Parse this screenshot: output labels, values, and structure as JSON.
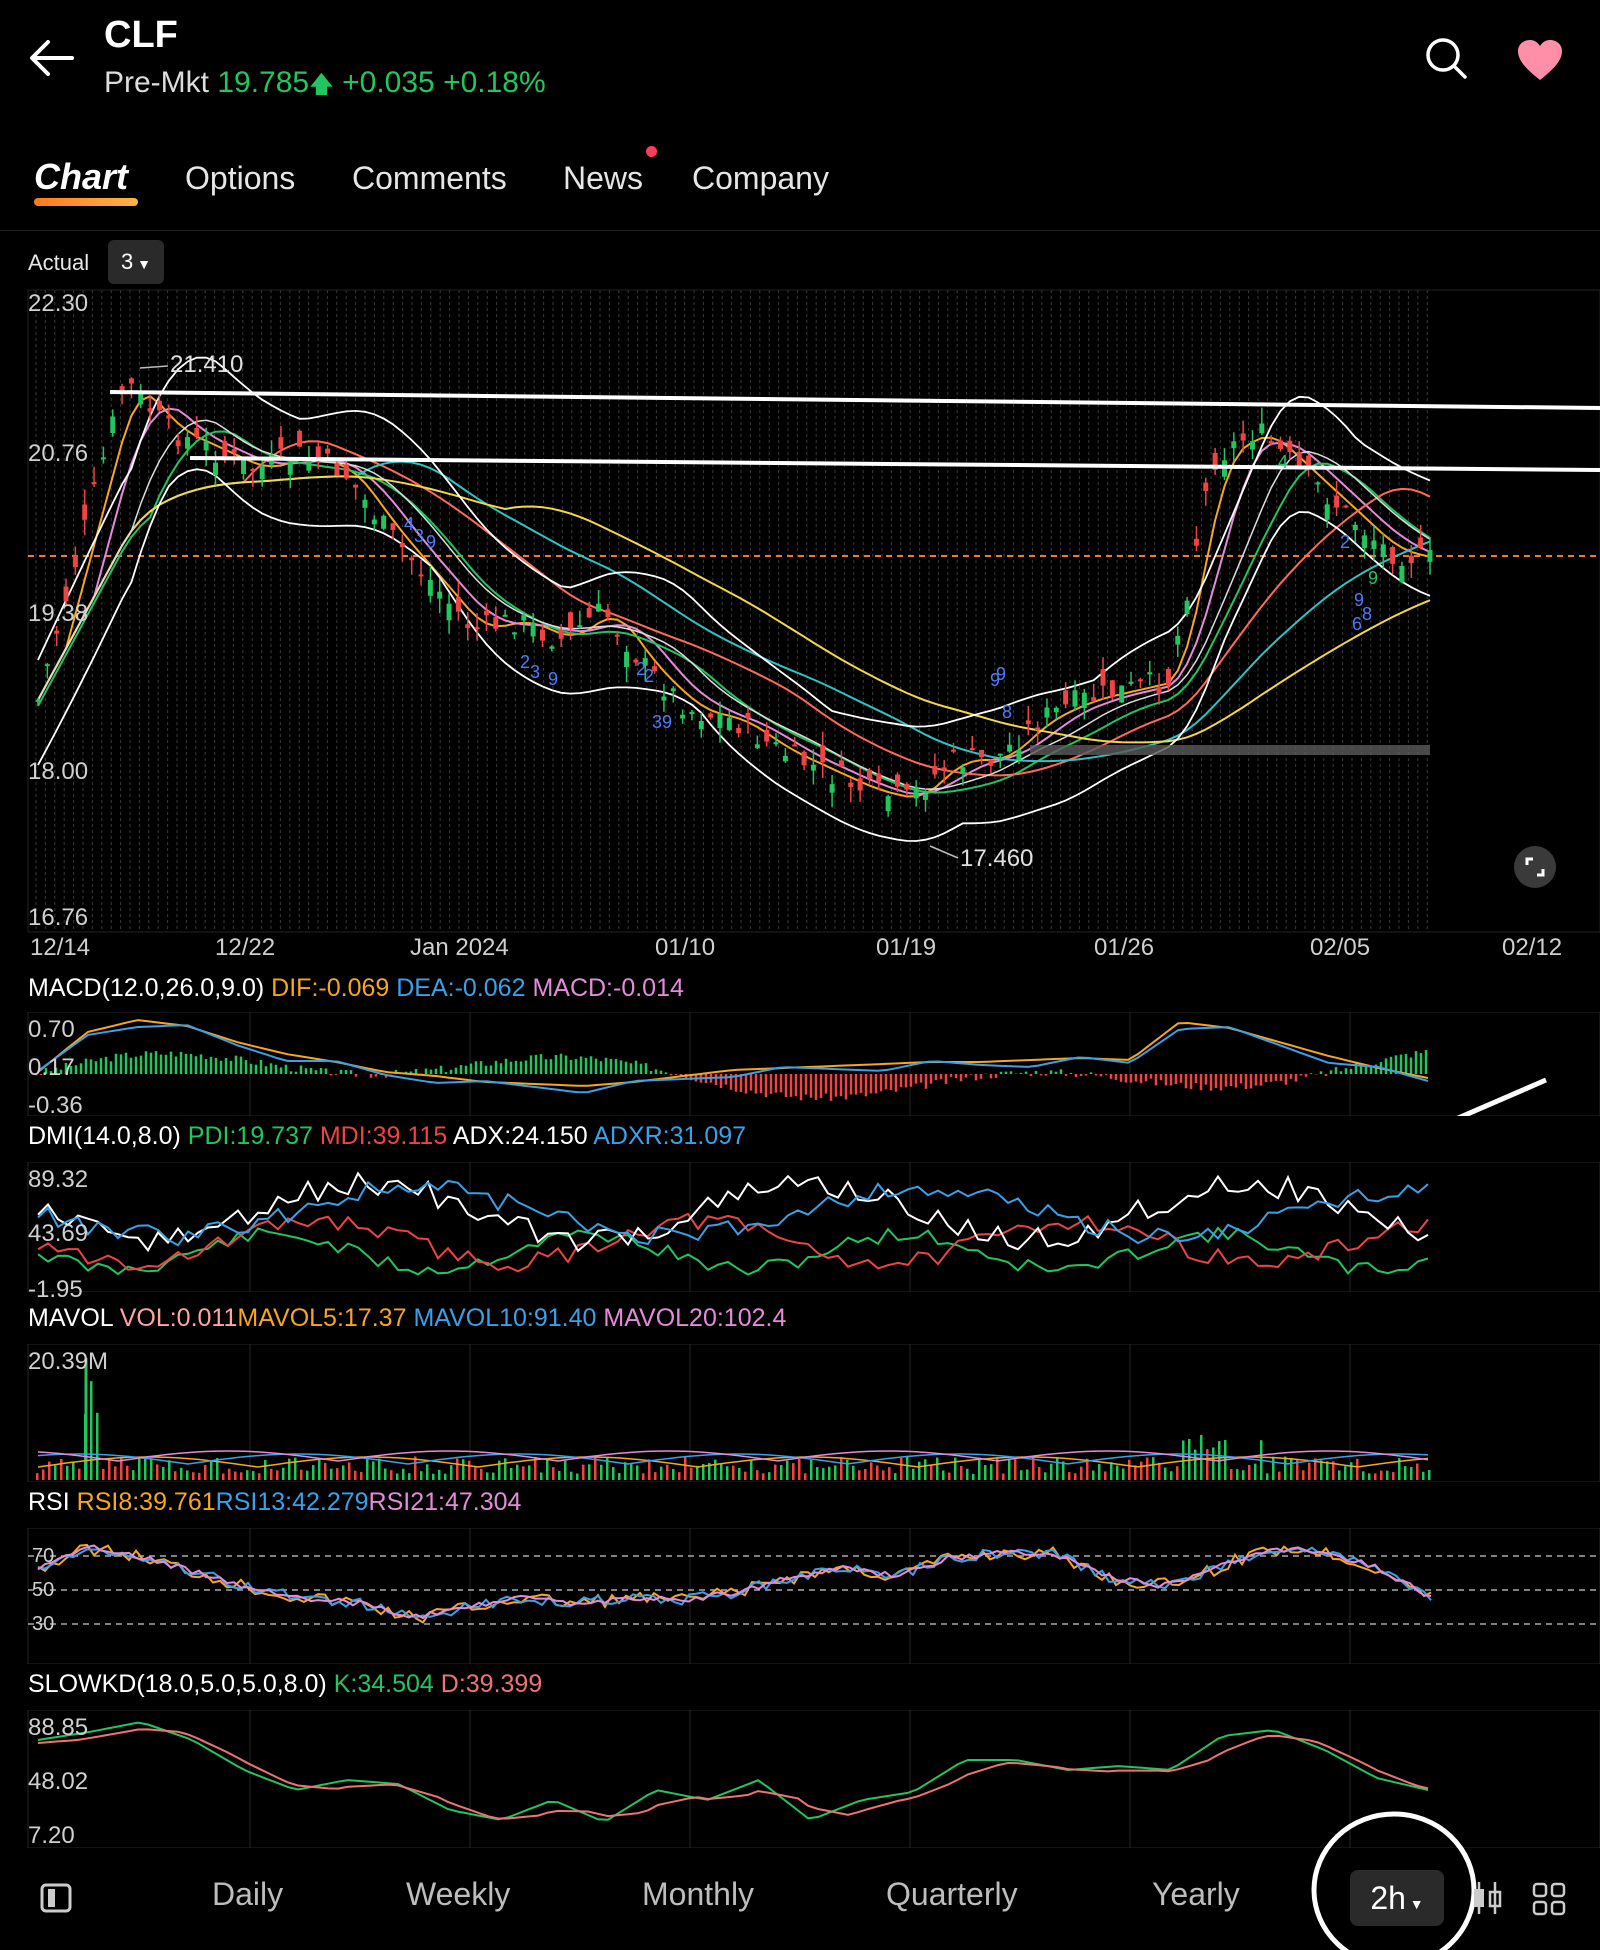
{
  "header": {
    "ticker": "CLF",
    "premarket_label": "Pre-Mkt",
    "premarket_price": "19.785",
    "premarket_change": "+0.035",
    "premarket_pct": "+0.18%"
  },
  "tabs": [
    "Chart",
    "Options",
    "Comments",
    "News",
    "Company"
  ],
  "toolbar": {
    "actual_label": "Actual",
    "adjust_value": "3"
  },
  "main_chart": {
    "y_ticks": [
      "22.30",
      "20.76",
      "19.38",
      "18.00",
      "16.76"
    ],
    "x_ticks": [
      "12/14",
      "12/22",
      "Jan 2024",
      "01/10",
      "01/19",
      "01/26",
      "02/05",
      "02/12"
    ],
    "high_label": "21.410",
    "low_label": "17.460",
    "seq_labels": [
      "4",
      "3",
      "9",
      "2",
      "3",
      "9",
      "2",
      "2",
      "3",
      "9",
      "9",
      "8",
      "9",
      "4",
      "9",
      "2",
      "9",
      "8",
      "6"
    ]
  },
  "macd": {
    "name": "MACD(12.0,26.0,9.0)",
    "dif": "DIF:-0.069",
    "dea": "DEA:-0.062",
    "macd": "MACD:-0.014",
    "y_ticks": [
      "0.70",
      "0.17",
      "-0.36"
    ]
  },
  "dmi": {
    "name": "DMI(14.0,8.0)",
    "pdi": "PDI:19.737",
    "mdi": "MDI:39.115",
    "adx": "ADX:24.150",
    "adxr": "ADXR:31.097",
    "y_ticks": [
      "89.32",
      "43.69",
      "-1.95"
    ]
  },
  "mavol": {
    "name": "MAVOL",
    "vol": "VOL:0.011",
    "mavol5": "MAVOL5:17.37",
    "mavol10": "MAVOL10:91.40",
    "mavol20": "MAVOL20:102.4",
    "y_tick": "20.39M"
  },
  "rsi": {
    "name": "RSI",
    "rsi8": "RSI8:39.761",
    "rsi13": "RSI13:42.279",
    "rsi21": "RSI21:47.304",
    "y_ticks": [
      "70",
      "50",
      "30"
    ]
  },
  "slowkd": {
    "name": "SLOWKD(18.0,5.0,5.0,8.0)",
    "k": "K:34.504",
    "d": "D:39.399",
    "y_ticks": [
      "88.85",
      "48.02",
      "7.20"
    ]
  },
  "periods": [
    "Daily",
    "Weekly",
    "Monthly",
    "Quarterly",
    "Yearly"
  ],
  "active_period": "2h",
  "colors": {
    "green": "#22c55e",
    "red": "#ef4444",
    "orange": "#f5a623",
    "blue": "#3aa0e8",
    "pink": "#e38bd8",
    "white": "#ffffff",
    "yellow": "#f2d64b",
    "teal": "#2ec4c4"
  }
}
